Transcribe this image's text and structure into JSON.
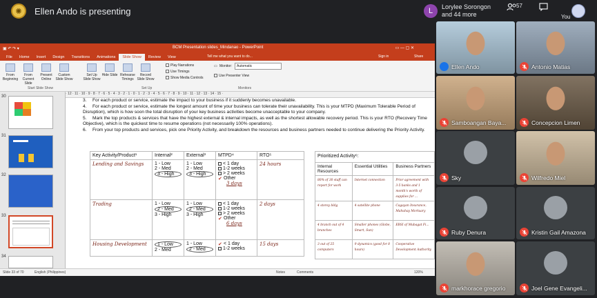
{
  "meeting": {
    "presenter_text": "Ellen Ando is presenting",
    "notif_name": "Lorylee Sorongon",
    "notif_more": "and 44 more",
    "notif_initial": "L",
    "participant_count": "57",
    "you_label": "You"
  },
  "powerpoint": {
    "doc_title": "BCM Presentation slides_Mindanao - PowerPoint",
    "tabs": [
      "File",
      "Home",
      "Insert",
      "Design",
      "Transitions",
      "Animations",
      "Slide Show",
      "Review",
      "View"
    ],
    "active_tab": "Slide Show",
    "tell_me": "Tell me what you want to do...",
    "sign_in": "Sign in",
    "share": "Share",
    "ribbon_buttons": [
      "From Beginning",
      "From Current Slide",
      "Present Online",
      "Custom Slide Show",
      "Set Up Slide Show",
      "Hide Slide",
      "Rehearse Timings",
      "Record Slide Show"
    ],
    "checkboxes": [
      "Play Narrations",
      "Use Timings",
      "Show Media Controls"
    ],
    "monitor_label": "Monitor:",
    "monitor_value": "Automatic",
    "presenter_view": "Use Presenter View",
    "group_labels": [
      "Start Slide Show",
      "Set Up",
      "Monitors"
    ],
    "status_left": "Slide 33 of 70",
    "status_lang": "English (Philippines)",
    "status_notes": "Notes",
    "status_comments": "Comments",
    "zoom": "120%"
  },
  "thumbnails": [
    {
      "num": "30"
    },
    {
      "num": "31"
    },
    {
      "num": "32"
    },
    {
      "num": "33"
    },
    {
      "num": "34"
    }
  ],
  "slide": {
    "steps": [
      {
        "n": "3.",
        "t": "For each product or service, estimate the impact to your business if it suddenly becomes unavailable."
      },
      {
        "n": "4.",
        "t": "For each product or service, estimate the longest amount of time your business can tolerate their unavailability. This is your MTPD (Maximum Tolerable Period of Disruption), which is how soon the total disruption of your key business activities become unacceptable to your company."
      },
      {
        "n": "5.",
        "t": "Mark the top products & services that have the highest external & internal impacts, as well as the shortest allowable recovery period. This is your RTO (Recovery Time Objective), which is the quickest time to resume operations (not necessarily 100% operations)."
      },
      {
        "n": "6.",
        "t": "From your top products and services, pick one Priority Activity, and breakdown the resources and business partners needed to continue delivering the Priority Activity."
      }
    ],
    "headers": {
      "activity": "Key Activity/Product¹",
      "internal": "Internal²",
      "external": "External³",
      "mtpd": "MTPD⁴",
      "rto": "RTO⁵"
    },
    "rows": [
      {
        "activity": "Lending and Savings",
        "internal": [
          "1 - Low",
          "2 - Med",
          "3 - High"
        ],
        "int_circ": 2,
        "external": [
          "1 - Low",
          "2 - Med",
          "3 - High"
        ],
        "ext_circ": 2,
        "mtpd": [
          "< 1 day",
          "1-2 weeks",
          "> 2 weeks",
          "Other"
        ],
        "mtpd_check": 3,
        "mtpd_note": "3 days",
        "rto": "24 hours"
      },
      {
        "activity": "Trading",
        "internal": [
          "1 - Low",
          "2 - Med",
          "3 - High"
        ],
        "int_circ": 1,
        "external": [
          "1 - Low",
          "2 - Med",
          "3 - High"
        ],
        "ext_circ": 1,
        "mtpd": [
          "< 1 day",
          "1-2 weeks",
          "> 2 weeks",
          "Other"
        ],
        "mtpd_check": 3,
        "mtpd_note": "6 days",
        "rto": "2 days"
      },
      {
        "activity": "Housing Development",
        "internal": [
          "1 - Low",
          "2 - Med"
        ],
        "int_circ": 0,
        "external": [
          "1 - Low",
          "2 - Med"
        ],
        "ext_circ": 1,
        "mtpd": [
          "< 1 day",
          "1-2 weeks"
        ],
        "mtpd_check": 0,
        "mtpd_note": "",
        "rto": "15 days"
      }
    ],
    "prio_title": "Prioritized Activity⁶:",
    "prio_headers": [
      "Internal Resources",
      "Essential Utilities",
      "Business Partners"
    ],
    "prio_rows": [
      [
        "80% of 30 staff can report for work",
        "Internet connection",
        "Prior agreement with 3-5 banks and 1 month's worth of supplies for ..."
      ],
      [
        "4 storey bldg",
        "4 satellite phone",
        "Cagayan Insurance, Mahuhay Mortuary"
      ],
      [
        "4 branch out of 4 branches",
        "Smaller phones (Globe, Smart, Sun)",
        "EBSI of Mubagat Fi..."
      ],
      [
        "3 out of 25 computers",
        "9 dynamics (good for 8 hours)",
        "Cooperative Development Authority"
      ]
    ]
  },
  "participants": [
    {
      "name": "Ellen Ando",
      "muted": false,
      "bg": "#a9c4d6"
    },
    {
      "name": "Antonio Matias",
      "muted": true,
      "bg": "#8fa0b2"
    },
    {
      "name": "Samboangan Baya...",
      "muted": true,
      "bg": "#c8a47a"
    },
    {
      "name": "Concepcion Limen",
      "muted": true,
      "bg": "#6b5a46"
    },
    {
      "name": "Sky",
      "muted": true,
      "bg": "#3c4043"
    },
    {
      "name": "Wilfredo Miel",
      "muted": true,
      "bg": "#c9b79a"
    },
    {
      "name": "Ruby Denura",
      "muted": true,
      "bg": "#3c4043"
    },
    {
      "name": "Kristin Gail Amazona",
      "muted": true,
      "bg": "#3c4043"
    },
    {
      "name": "markhorace gregorio",
      "muted": true,
      "bg": "#b8b2a8"
    },
    {
      "name": "Joel Gene Evangeli...",
      "muted": true,
      "bg": "#3c4043"
    }
  ]
}
